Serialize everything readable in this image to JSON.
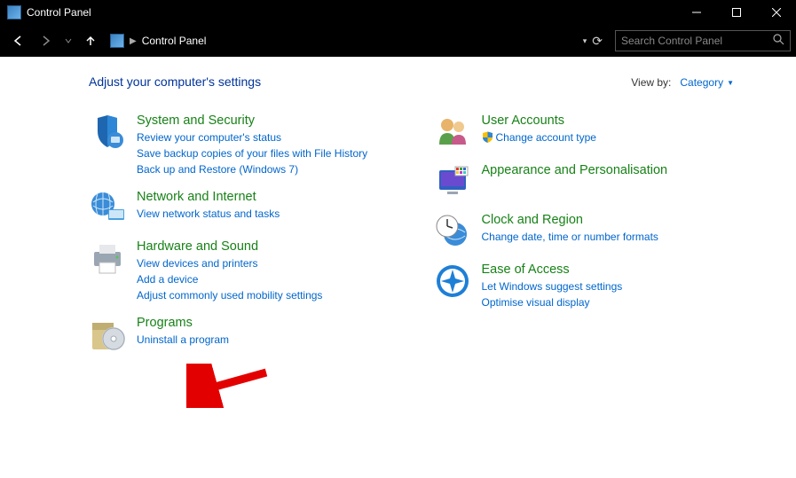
{
  "titlebar": {
    "title": "Control Panel"
  },
  "nav": {
    "address_label": "Control Panel",
    "search_placeholder": "Search Control Panel"
  },
  "header": {
    "heading": "Adjust your computer's settings",
    "view_by_label": "View by:",
    "view_by_value": "Category"
  },
  "cols": [
    [
      {
        "icon": "shield-pc-icon",
        "title": "System and Security",
        "links": [
          {
            "shield": false,
            "text": "Review your computer's status"
          },
          {
            "shield": false,
            "text": "Save backup copies of your files with File History"
          },
          {
            "shield": false,
            "text": "Back up and Restore (Windows 7)"
          }
        ]
      },
      {
        "icon": "globe-network-icon",
        "title": "Network and Internet",
        "links": [
          {
            "shield": false,
            "text": "View network status and tasks"
          }
        ]
      },
      {
        "icon": "printer-icon",
        "title": "Hardware and Sound",
        "links": [
          {
            "shield": false,
            "text": "View devices and printers"
          },
          {
            "shield": false,
            "text": "Add a device"
          },
          {
            "shield": false,
            "text": "Adjust commonly used mobility settings"
          }
        ]
      },
      {
        "icon": "disc-box-icon",
        "title": "Programs",
        "links": [
          {
            "shield": false,
            "text": "Uninstall a program"
          }
        ]
      }
    ],
    [
      {
        "icon": "people-icon",
        "title": "User Accounts",
        "links": [
          {
            "shield": true,
            "text": "Change account type"
          }
        ]
      },
      {
        "icon": "monitor-theme-icon",
        "title": "Appearance and Personalisation",
        "links": []
      },
      {
        "icon": "clock-globe-icon",
        "title": "Clock and Region",
        "links": [
          {
            "shield": false,
            "text": "Change date, time or number formats"
          }
        ]
      },
      {
        "icon": "ease-access-icon",
        "title": "Ease of Access",
        "links": [
          {
            "shield": false,
            "text": "Let Windows suggest settings"
          },
          {
            "shield": false,
            "text": "Optimise visual display"
          }
        ]
      }
    ]
  ]
}
